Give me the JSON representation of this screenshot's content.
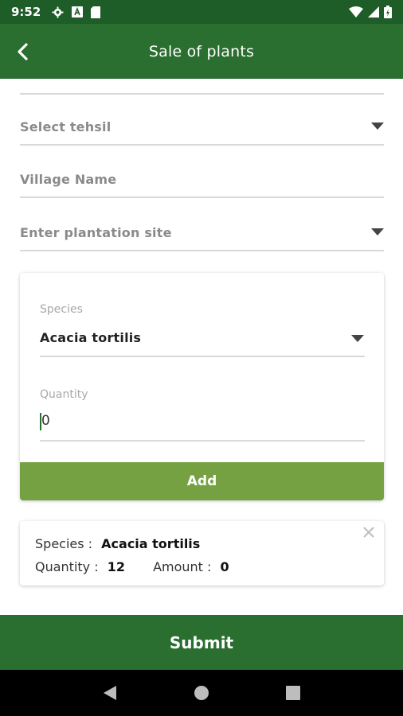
{
  "status_bar": {
    "time": "9:52",
    "icons": [
      "gear-icon",
      "a-icon",
      "sd-card-icon"
    ],
    "right_icons": [
      "wifi-icon",
      "signal-icon",
      "battery-icon"
    ]
  },
  "app_bar": {
    "title": "Sale of plants",
    "back_icon": "chevron-left-icon"
  },
  "form": {
    "tehsil_placeholder": "Select tehsil",
    "village_placeholder": "Village Name",
    "plantation_placeholder": "Enter plantation site"
  },
  "species_card": {
    "species_label": "Species",
    "species_value": "Acacia tortilis",
    "quantity_label": "Quantity",
    "quantity_value": "0",
    "add_label": "Add"
  },
  "entry": {
    "species_label": "Species :",
    "species_value": "Acacia tortilis",
    "quantity_label": "Quantity :",
    "quantity_value": "12",
    "amount_label": "Amount :",
    "amount_value": "0"
  },
  "submit_label": "Submit",
  "colors": {
    "primary": "#2a6e30",
    "status": "#1e5c28",
    "accent": "#76a142"
  }
}
